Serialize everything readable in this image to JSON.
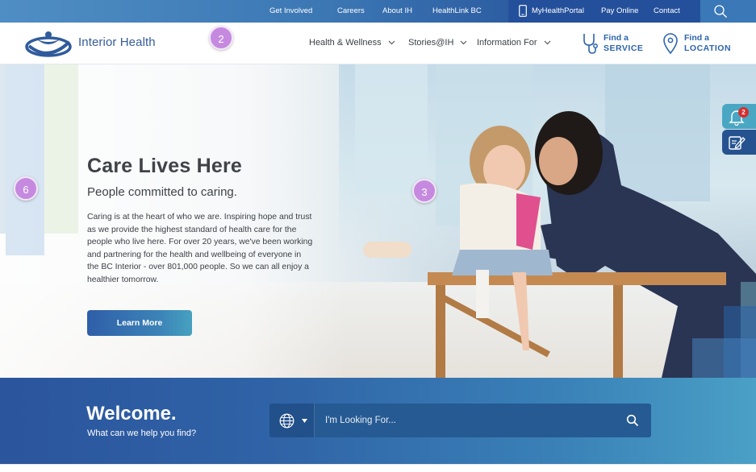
{
  "topbar": {
    "links": [
      {
        "label": "Get Involved"
      },
      {
        "label": "Careers"
      },
      {
        "label": "About IH"
      },
      {
        "label": "HealthLink BC"
      }
    ],
    "portal_label": "MyHealthPortal",
    "pay_label": "Pay Online",
    "contact_label": "Contact",
    "search_icon": "search-icon"
  },
  "nav": {
    "logo_text": "Interior Health",
    "items": [
      {
        "label": "Health & Wellness"
      },
      {
        "label": "Stories@IH"
      },
      {
        "label": "Information For"
      }
    ],
    "find_service": {
      "line1": "Find a",
      "line2": "SERVICE",
      "icon": "stethoscope-icon"
    },
    "find_location": {
      "line1": "Find a",
      "line2": "LOCATION",
      "icon": "map-pin-icon"
    }
  },
  "hero": {
    "title": "Care Lives Here",
    "subtitle": "People committed to caring.",
    "body": "Caring is at the heart of who we are. Inspiring hope and trust as we provide the highest standard of health care for the people who live here. For over 20 years, we've been working and partnering for the health and wellbeing of everyone in the BC Interior - over 801,000 people. So we can all enjoy a healthier tomorrow.",
    "cta_label": "Learn More"
  },
  "markers": [
    "2",
    "3",
    "6"
  ],
  "side_tabs": {
    "notification_count": "2"
  },
  "welcome": {
    "title": "Welcome.",
    "subtitle": "What can we help you find?",
    "search_placeholder": "I'm Looking For..."
  },
  "colors": {
    "brand_blue": "#2d64ad",
    "topbar_dark": "#24509b",
    "marker_purple": "#c58ae0",
    "badge_red": "#d42f2f"
  }
}
